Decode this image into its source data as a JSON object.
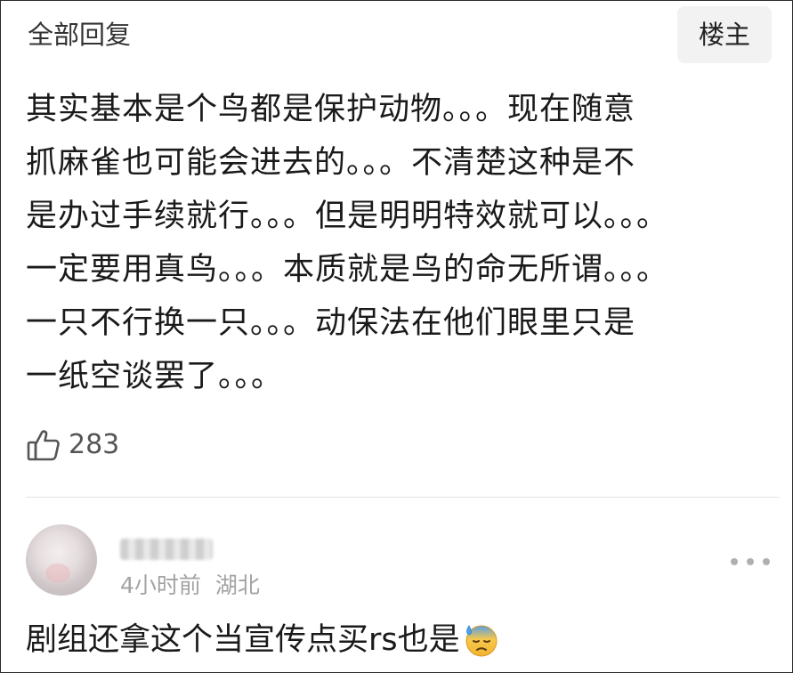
{
  "header": {
    "title": "全部回复",
    "op_badge": "楼主"
  },
  "comment": {
    "lines": [
      "其实基本是个鸟都是保护动物。。。现在随意",
      "抓麻雀也可能会进去的。。。不清楚这种是不",
      "是办过手续就行。。。但是明明特效就可以。。。",
      "一定要用真鸟。。。本质就是鸟的命无所谓。。。",
      "一只不行换一只。。。动保法在他们眼里只是",
      "一纸空谈罢了。。。"
    ],
    "likes": "283",
    "like_icon": "thumbs-up-icon"
  },
  "reply": {
    "time": "4小时前",
    "location": "湖北",
    "text": "剧组还拿这个当宣传点买rs也是",
    "emoji": "downcast-sweat-face-emoji",
    "more_icon": "more-dots-icon"
  }
}
